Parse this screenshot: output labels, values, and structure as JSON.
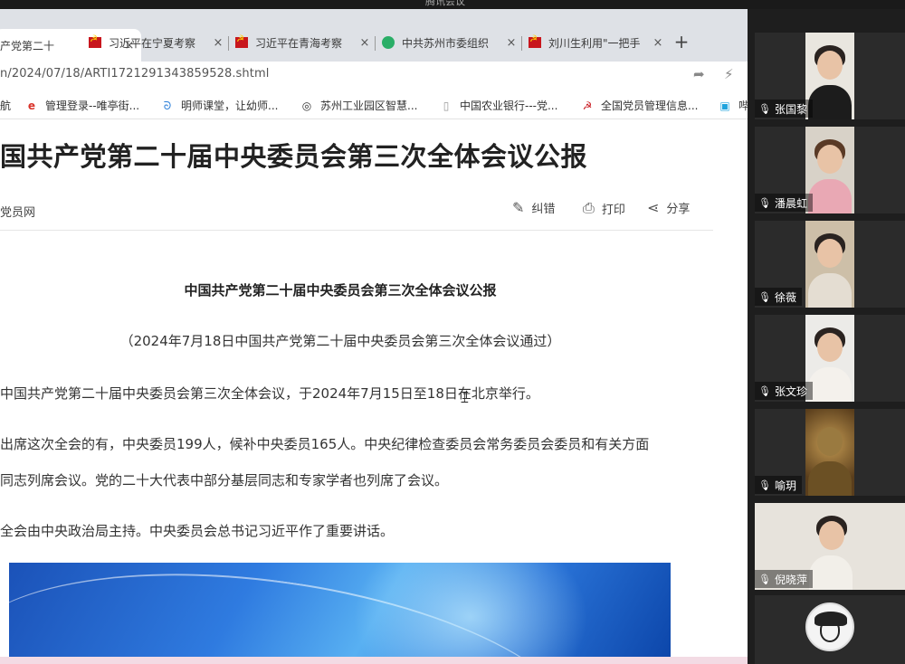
{
  "meeting": {
    "window_title": "腾讯会议"
  },
  "browser": {
    "tabs": [
      {
        "label": "产党第二十",
        "favicon": "party-emblem-icon",
        "active": true
      },
      {
        "label": "习近平在宁夏考察",
        "favicon": "party-emblem-icon",
        "active": false
      },
      {
        "label": "习近平在青海考察",
        "favicon": "party-emblem-icon",
        "active": false
      },
      {
        "label": "中共苏州市委组织",
        "favicon": "wechat-icon",
        "active": false
      },
      {
        "label": "刘川生利用\"一把手",
        "favicon": "party-emblem-icon",
        "active": false
      }
    ],
    "new_tab_label": "+",
    "close_glyph": "×",
    "url": "n/2024/07/18/ARTI1721291343859528.shtml",
    "bookmarks": [
      {
        "label": "航",
        "icon": "none"
      },
      {
        "label": "管理登录--唯亭街...",
        "icon": "ie-icon"
      },
      {
        "label": "明师课堂，让幼师...",
        "icon": "edge-icon"
      },
      {
        "label": "苏州工业园区智慧...",
        "icon": "circle-logo-icon"
      },
      {
        "label": "中国农业银行---党...",
        "icon": "page-icon"
      },
      {
        "label": "全国党员管理信息...",
        "icon": "party-emblem-icon"
      },
      {
        "label": "哔",
        "icon": "bilibili-icon"
      }
    ]
  },
  "article": {
    "headline": "国共产党第二十届中央委员会第三次全体会议公报",
    "source": "党员网",
    "tools": {
      "correct": "纠错",
      "print": "打印",
      "share": "分享"
    },
    "title": "中国共产党第二十届中央委员会第三次全体会议公报",
    "subtitle": "（2024年7月18日中国共产党第二十届中央委员会第三次全体会议通过）",
    "paragraphs": [
      "中国共产党第二十届中央委员会第三次全体会议，于2024年7月15日至18日在北京举行。",
      "出席这次全会的有，中央委员199人，候补中央委员165人。中央纪律检查委员会常务委员会委员和有关方面",
      "同志列席会议。党的二十大代表中部分基层同志和专家学者也列席了会议。",
      "全会由中央政治局主持。中央委员会总书记习近平作了重要讲话。"
    ]
  },
  "participants": [
    {
      "name": "张国黎"
    },
    {
      "name": "潘晨虹"
    },
    {
      "name": "徐薇"
    },
    {
      "name": "张文珍"
    },
    {
      "name": "喻玥"
    },
    {
      "name": "倪晓萍"
    }
  ],
  "colors": {
    "tabbar": "#dee1e6",
    "sidebar": "#1e1e1e",
    "party_red": "#c8161d",
    "wechat_green": "#2aae67"
  }
}
